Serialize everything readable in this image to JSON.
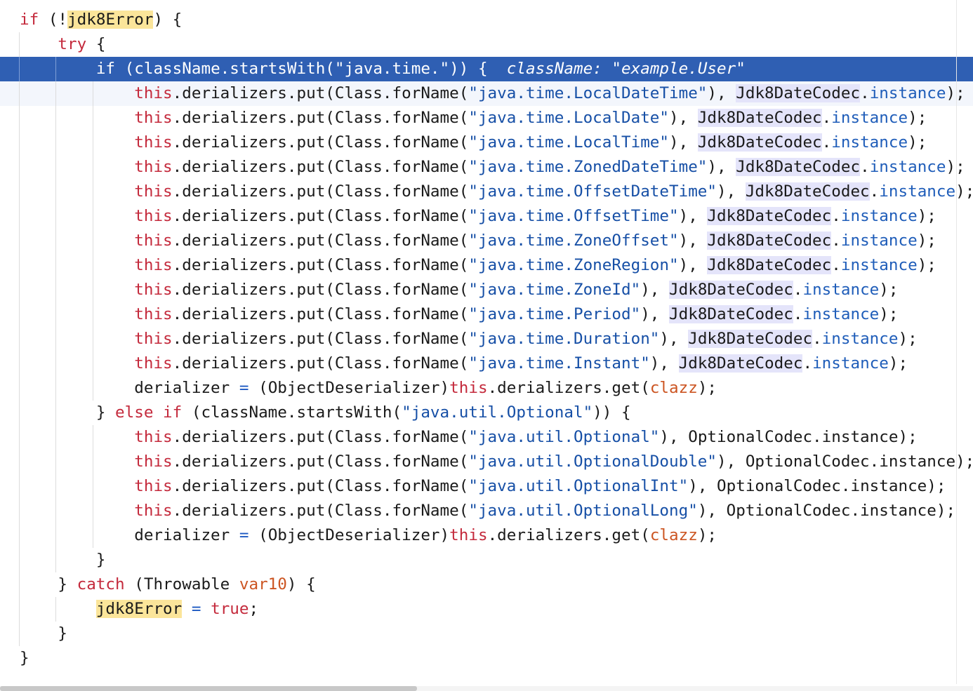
{
  "lines": [
    {
      "kind": "normal",
      "depth": 0,
      "tokens": [
        {
          "t": "if",
          "c": "kw"
        },
        {
          "t": " (!"
        },
        {
          "t": "jdk8Error",
          "c": "hl"
        },
        {
          "t": ") {"
        }
      ]
    },
    {
      "kind": "normal",
      "depth": 1,
      "tokens": [
        {
          "t": "    "
        },
        {
          "t": "try",
          "c": "kw"
        },
        {
          "t": " {"
        }
      ]
    },
    {
      "kind": "exec",
      "depth": 2,
      "tokens": [
        {
          "t": "        "
        },
        {
          "t": "if"
        },
        {
          "t": " (className.startsWith(\"java.time.\")) {"
        },
        {
          "t": "  className: \"example.User\"",
          "c": "hint"
        }
      ]
    },
    {
      "kind": "caret",
      "depth": 3,
      "tokens": [
        {
          "t": "            "
        },
        {
          "t": "this",
          "c": "kw"
        },
        {
          "t": ".derializers.put(Class.forName("
        },
        {
          "t": "\"java.time.LocalDateTime\"",
          "c": "str"
        },
        {
          "t": "), "
        },
        {
          "t": "Jdk8DateCodec",
          "c": "cls"
        },
        {
          "t": "."
        },
        {
          "t": "instance",
          "c": "fld"
        },
        {
          "t": ");"
        }
      ]
    },
    {
      "kind": "normal",
      "depth": 3,
      "tokens": [
        {
          "t": "            "
        },
        {
          "t": "this",
          "c": "kw"
        },
        {
          "t": ".derializers.put(Class.forName("
        },
        {
          "t": "\"java.time.LocalDate\"",
          "c": "str"
        },
        {
          "t": "), "
        },
        {
          "t": "Jdk8DateCodec",
          "c": "cls"
        },
        {
          "t": "."
        },
        {
          "t": "instance",
          "c": "fld"
        },
        {
          "t": ");"
        }
      ]
    },
    {
      "kind": "normal",
      "depth": 3,
      "tokens": [
        {
          "t": "            "
        },
        {
          "t": "this",
          "c": "kw"
        },
        {
          "t": ".derializers.put(Class.forName("
        },
        {
          "t": "\"java.time.LocalTime\"",
          "c": "str"
        },
        {
          "t": "), "
        },
        {
          "t": "Jdk8DateCodec",
          "c": "cls"
        },
        {
          "t": "."
        },
        {
          "t": "instance",
          "c": "fld"
        },
        {
          "t": ");"
        }
      ]
    },
    {
      "kind": "normal",
      "depth": 3,
      "tokens": [
        {
          "t": "            "
        },
        {
          "t": "this",
          "c": "kw"
        },
        {
          "t": ".derializers.put(Class.forName("
        },
        {
          "t": "\"java.time.ZonedDateTime\"",
          "c": "str"
        },
        {
          "t": "), "
        },
        {
          "t": "Jdk8DateCodec",
          "c": "cls"
        },
        {
          "t": "."
        },
        {
          "t": "instance",
          "c": "fld"
        },
        {
          "t": ");"
        }
      ]
    },
    {
      "kind": "normal",
      "depth": 3,
      "tokens": [
        {
          "t": "            "
        },
        {
          "t": "this",
          "c": "kw"
        },
        {
          "t": ".derializers.put(Class.forName("
        },
        {
          "t": "\"java.time.OffsetDateTime\"",
          "c": "str"
        },
        {
          "t": "), "
        },
        {
          "t": "Jdk8DateCodec",
          "c": "cls"
        },
        {
          "t": "."
        },
        {
          "t": "instance",
          "c": "fld"
        },
        {
          "t": ");"
        }
      ]
    },
    {
      "kind": "normal",
      "depth": 3,
      "tokens": [
        {
          "t": "            "
        },
        {
          "t": "this",
          "c": "kw"
        },
        {
          "t": ".derializers.put(Class.forName("
        },
        {
          "t": "\"java.time.OffsetTime\"",
          "c": "str"
        },
        {
          "t": "), "
        },
        {
          "t": "Jdk8DateCodec",
          "c": "cls"
        },
        {
          "t": "."
        },
        {
          "t": "instance",
          "c": "fld"
        },
        {
          "t": ");"
        }
      ]
    },
    {
      "kind": "normal",
      "depth": 3,
      "tokens": [
        {
          "t": "            "
        },
        {
          "t": "this",
          "c": "kw"
        },
        {
          "t": ".derializers.put(Class.forName("
        },
        {
          "t": "\"java.time.ZoneOffset\"",
          "c": "str"
        },
        {
          "t": "), "
        },
        {
          "t": "Jdk8DateCodec",
          "c": "cls"
        },
        {
          "t": "."
        },
        {
          "t": "instance",
          "c": "fld"
        },
        {
          "t": ");"
        }
      ]
    },
    {
      "kind": "normal",
      "depth": 3,
      "tokens": [
        {
          "t": "            "
        },
        {
          "t": "this",
          "c": "kw"
        },
        {
          "t": ".derializers.put(Class.forName("
        },
        {
          "t": "\"java.time.ZoneRegion\"",
          "c": "str"
        },
        {
          "t": "), "
        },
        {
          "t": "Jdk8DateCodec",
          "c": "cls"
        },
        {
          "t": "."
        },
        {
          "t": "instance",
          "c": "fld"
        },
        {
          "t": ");"
        }
      ]
    },
    {
      "kind": "normal",
      "depth": 3,
      "tokens": [
        {
          "t": "            "
        },
        {
          "t": "this",
          "c": "kw"
        },
        {
          "t": ".derializers.put(Class.forName("
        },
        {
          "t": "\"java.time.ZoneId\"",
          "c": "str"
        },
        {
          "t": "), "
        },
        {
          "t": "Jdk8DateCodec",
          "c": "cls"
        },
        {
          "t": "."
        },
        {
          "t": "instance",
          "c": "fld"
        },
        {
          "t": ");"
        }
      ]
    },
    {
      "kind": "normal",
      "depth": 3,
      "tokens": [
        {
          "t": "            "
        },
        {
          "t": "this",
          "c": "kw"
        },
        {
          "t": ".derializers.put(Class.forName("
        },
        {
          "t": "\"java.time.Period\"",
          "c": "str"
        },
        {
          "t": "), "
        },
        {
          "t": "Jdk8DateCodec",
          "c": "cls"
        },
        {
          "t": "."
        },
        {
          "t": "instance",
          "c": "fld"
        },
        {
          "t": ");"
        }
      ]
    },
    {
      "kind": "normal",
      "depth": 3,
      "tokens": [
        {
          "t": "            "
        },
        {
          "t": "this",
          "c": "kw"
        },
        {
          "t": ".derializers.put(Class.forName("
        },
        {
          "t": "\"java.time.Duration\"",
          "c": "str"
        },
        {
          "t": "), "
        },
        {
          "t": "Jdk8DateCodec",
          "c": "cls"
        },
        {
          "t": "."
        },
        {
          "t": "instance",
          "c": "fld"
        },
        {
          "t": ");"
        }
      ]
    },
    {
      "kind": "normal",
      "depth": 3,
      "tokens": [
        {
          "t": "            "
        },
        {
          "t": "this",
          "c": "kw"
        },
        {
          "t": ".derializers.put(Class.forName("
        },
        {
          "t": "\"java.time.Instant\"",
          "c": "str"
        },
        {
          "t": "), "
        },
        {
          "t": "Jdk8DateCodec",
          "c": "cls"
        },
        {
          "t": "."
        },
        {
          "t": "instance",
          "c": "fld"
        },
        {
          "t": ");"
        }
      ]
    },
    {
      "kind": "normal",
      "depth": 3,
      "tokens": [
        {
          "t": "            derializer "
        },
        {
          "t": "=",
          "c": "op"
        },
        {
          "t": " (ObjectDeserializer)"
        },
        {
          "t": "this",
          "c": "kw"
        },
        {
          "t": ".derializers.get("
        },
        {
          "t": "clazz",
          "c": "par"
        },
        {
          "t": ");"
        }
      ]
    },
    {
      "kind": "normal",
      "depth": 2,
      "tokens": [
        {
          "t": "        } "
        },
        {
          "t": "else if",
          "c": "kw"
        },
        {
          "t": " (className.startsWith("
        },
        {
          "t": "\"java.util.Optional\"",
          "c": "str"
        },
        {
          "t": ")) {"
        }
      ]
    },
    {
      "kind": "normal",
      "depth": 3,
      "tokens": [
        {
          "t": "            "
        },
        {
          "t": "this",
          "c": "kw"
        },
        {
          "t": ".derializers.put(Class.forName("
        },
        {
          "t": "\"java.util.Optional\"",
          "c": "str"
        },
        {
          "t": "), OptionalCodec.instance);"
        }
      ]
    },
    {
      "kind": "normal",
      "depth": 3,
      "tokens": [
        {
          "t": "            "
        },
        {
          "t": "this",
          "c": "kw"
        },
        {
          "t": ".derializers.put(Class.forName("
        },
        {
          "t": "\"java.util.OptionalDouble\"",
          "c": "str"
        },
        {
          "t": "), OptionalCodec.instance);"
        }
      ]
    },
    {
      "kind": "normal",
      "depth": 3,
      "tokens": [
        {
          "t": "            "
        },
        {
          "t": "this",
          "c": "kw"
        },
        {
          "t": ".derializers.put(Class.forName("
        },
        {
          "t": "\"java.util.OptionalInt\"",
          "c": "str"
        },
        {
          "t": "), OptionalCodec.instance);"
        }
      ]
    },
    {
      "kind": "normal",
      "depth": 3,
      "tokens": [
        {
          "t": "            "
        },
        {
          "t": "this",
          "c": "kw"
        },
        {
          "t": ".derializers.put(Class.forName("
        },
        {
          "t": "\"java.util.OptionalLong\"",
          "c": "str"
        },
        {
          "t": "), OptionalCodec.instance);"
        }
      ]
    },
    {
      "kind": "normal",
      "depth": 3,
      "tokens": [
        {
          "t": "            derializer "
        },
        {
          "t": "=",
          "c": "op"
        },
        {
          "t": " (ObjectDeserializer)"
        },
        {
          "t": "this",
          "c": "kw"
        },
        {
          "t": ".derializers.get("
        },
        {
          "t": "clazz",
          "c": "par"
        },
        {
          "t": ");"
        }
      ]
    },
    {
      "kind": "normal",
      "depth": 2,
      "tokens": [
        {
          "t": "        }"
        }
      ]
    },
    {
      "kind": "normal",
      "depth": 1,
      "tokens": [
        {
          "t": "    } "
        },
        {
          "t": "catch",
          "c": "kw"
        },
        {
          "t": " (Throwable "
        },
        {
          "t": "var10",
          "c": "par"
        },
        {
          "t": ") {"
        }
      ]
    },
    {
      "kind": "normal",
      "depth": 2,
      "tokens": [
        {
          "t": "        "
        },
        {
          "t": "jdk8Error",
          "c": "hl"
        },
        {
          "t": " "
        },
        {
          "t": "=",
          "c": "op"
        },
        {
          "t": " "
        },
        {
          "t": "true",
          "c": "kw"
        },
        {
          "t": ";"
        }
      ]
    },
    {
      "kind": "normal",
      "depth": 1,
      "tokens": [
        {
          "t": "    }"
        }
      ]
    },
    {
      "kind": "normal",
      "depth": 0,
      "tokens": [
        {
          "t": "}"
        }
      ]
    }
  ],
  "colors": {
    "keyword": "#c42a3c",
    "string": "#164fa6",
    "field": "#1f5db9",
    "parameter": "#cc5522",
    "execution_line": "#2f5fb3",
    "class_highlight": "#e4e4fa",
    "usage_highlight": "#fbe59a"
  }
}
